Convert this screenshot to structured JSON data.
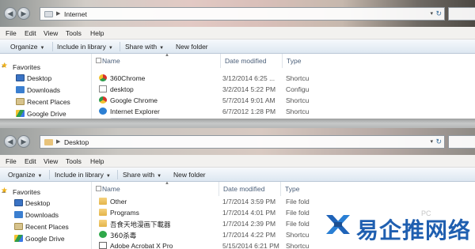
{
  "top_window": {
    "address_path": "Internet",
    "menu": [
      "File",
      "Edit",
      "View",
      "Tools",
      "Help"
    ],
    "toolbar": {
      "organize": "Organize",
      "include": "Include in library",
      "share": "Share with",
      "new_folder": "New folder"
    },
    "nav": {
      "favorites": "Favorites",
      "items": [
        "Desktop",
        "Downloads",
        "Recent Places",
        "Google Drive"
      ]
    },
    "columns": {
      "name": "Name",
      "date": "Date modified",
      "type": "Type"
    },
    "rows": [
      {
        "name": "360Chrome",
        "date": "3/12/2014 6:25 ...",
        "type": "Shortcu",
        "icon": "360chrome-icon"
      },
      {
        "name": "desktop",
        "date": "3/2/2014 5:22 PM",
        "type": "Configu",
        "icon": "config-file-icon"
      },
      {
        "name": "Google Chrome",
        "date": "5/7/2014 9:01 AM",
        "type": "Shortcu",
        "icon": "chrome-icon"
      },
      {
        "name": "Internet Explorer",
        "date": "6/7/2012 1:28 PM",
        "type": "Shortcu",
        "icon": "ie-icon"
      }
    ]
  },
  "bottom_window": {
    "address_path": "Desktop",
    "menu": [
      "File",
      "Edit",
      "View",
      "Tools",
      "Help"
    ],
    "toolbar": {
      "organize": "Organize",
      "include": "Include in library",
      "share": "Share with",
      "new_folder": "New folder"
    },
    "nav": {
      "favorites": "Favorites",
      "items": [
        "Desktop",
        "Downloads",
        "Recent Places",
        "Google Drive"
      ]
    },
    "columns": {
      "name": "Name",
      "date": "Date modified",
      "type": "Type"
    },
    "rows": [
      {
        "name": "Other",
        "date": "1/7/2014 3:59 PM",
        "type": "File fold",
        "icon": "folder-icon"
      },
      {
        "name": "Programs",
        "date": "1/7/2014 4:01 PM",
        "type": "File fold",
        "icon": "folder-icon"
      },
      {
        "name": "吾食天地漫画下載器",
        "date": "1/7/2014 2:39 PM",
        "type": "File fold",
        "icon": "folder-icon"
      },
      {
        "name": "360杀毒",
        "date": "1/7/2014 4:22 PM",
        "type": "Shortcu",
        "icon": "360-antivirus-icon"
      },
      {
        "name": "Adobe Acrobat X Pro",
        "date": "5/15/2014 6:21 PM",
        "type": "Shortcu",
        "icon": "acrobat-icon"
      }
    ]
  },
  "watermark": {
    "text": "易企推网络",
    "pc_mark": "PC"
  }
}
